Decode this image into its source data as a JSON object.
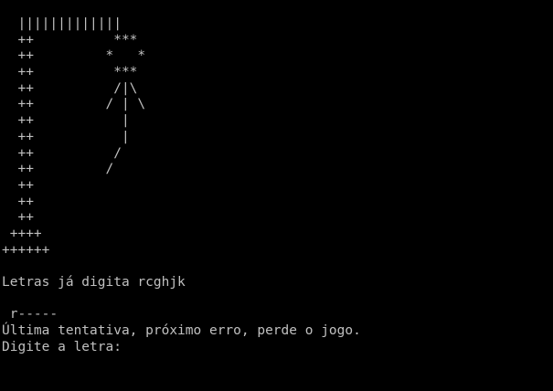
{
  "theme": {
    "background": "#000000",
    "foreground": "#c0c0c0"
  },
  "gallows": [
    "  |||||||||||||",
    "  ++          ***",
    "  ++         *   *",
    "  ++          ***",
    "  ++          /|\\",
    "  ++         / | \\",
    "  ++           |",
    "  ++           |",
    "  ++          /",
    "  ++         /",
    "  ++",
    "  ++",
    "  ++",
    " ++++",
    "++++++"
  ],
  "guessed_letters_line": "Letras já digita rcghjk",
  "word_progress": " r-----",
  "warning_line": "Última tentativa, próximo erro, perde o jogo.",
  "input_prompt": "Digite a letra:"
}
